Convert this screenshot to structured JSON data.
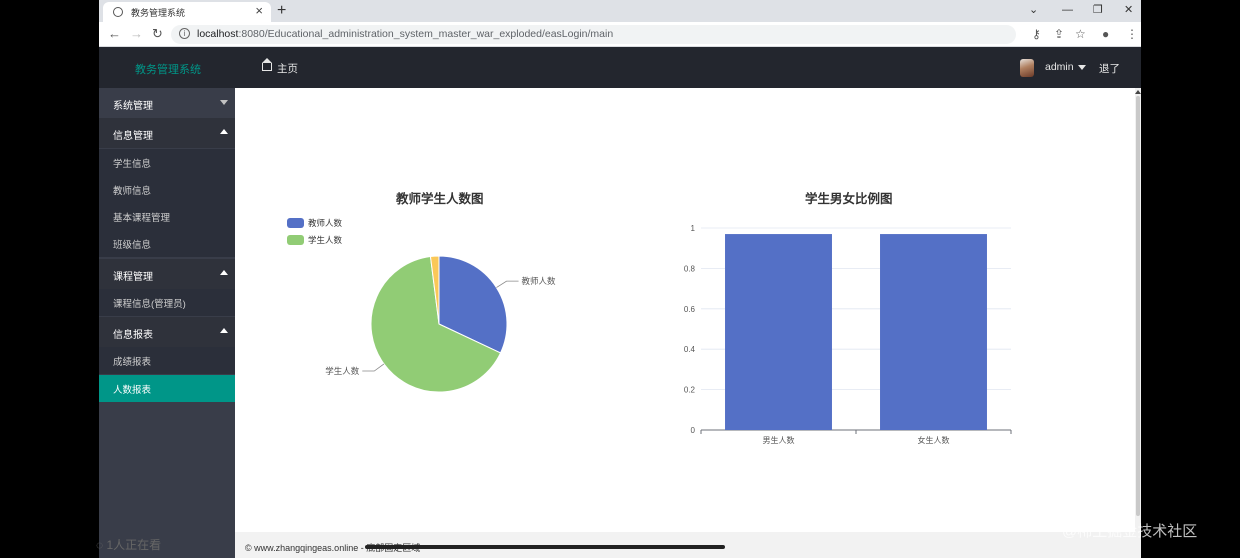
{
  "browser": {
    "tab_title": "教务管理系统",
    "url_host": "localhost",
    "url_rest": ":8080/Educational_administration_system_master_war_exploded/easLogin/main"
  },
  "header": {
    "logo": "教务管理系统",
    "home": "主页",
    "user": "admin",
    "logout": "退了"
  },
  "sidebar": {
    "groups": [
      {
        "label": "系统管理",
        "expanded": false
      },
      {
        "label": "信息管理",
        "expanded": true,
        "items": [
          "学生信息",
          "教师信息",
          "基本课程管理",
          "班级信息"
        ]
      },
      {
        "label": "课程管理",
        "expanded": true,
        "items": [
          "课程信息(管理员)"
        ]
      },
      {
        "label": "信息报表",
        "expanded": true,
        "items": [
          "成绩报表",
          "人数报表"
        ]
      }
    ],
    "active_item": "人数报表"
  },
  "charts": {
    "pie_title": "教师学生人数图",
    "bar_title": "学生男女比例图"
  },
  "chart_data": [
    {
      "type": "pie",
      "title": "教师学生人数图",
      "legend": [
        "教师人数",
        "学生人数"
      ],
      "legend_position": "top-left",
      "slices": [
        {
          "label": "教师人数",
          "value": 32,
          "color": "#5470c6"
        },
        {
          "label": "学生人数",
          "value": 66,
          "color": "#91cc75"
        },
        {
          "label": "",
          "value": 2,
          "color": "#fac858"
        }
      ]
    },
    {
      "type": "bar",
      "title": "学生男女比例图",
      "categories": [
        "男生人数",
        "女生人数"
      ],
      "values": [
        0.97,
        0.97
      ],
      "ylim": [
        0,
        1
      ],
      "yticks": [
        "0",
        "0.2",
        "0.4",
        "0.6",
        "0.8",
        "1"
      ],
      "color": "#5470c6",
      "grid": true
    }
  ],
  "footer": {
    "text": "© www.zhangqingeas.online - 底部固定区域"
  },
  "overlay": {
    "viewers": "1人正在看",
    "watermark": "@稀土掘金技术社区"
  }
}
